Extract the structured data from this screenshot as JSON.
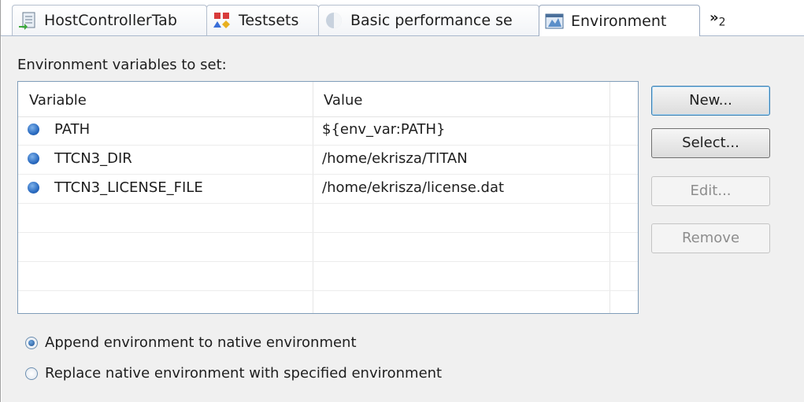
{
  "tabs": [
    {
      "label": "HostControllerTab",
      "icon": "host-controller-icon",
      "active": false
    },
    {
      "label": "Testsets",
      "icon": "testsets-icon",
      "active": false
    },
    {
      "label": "Basic performance se",
      "icon": "performance-icon",
      "active": false
    },
    {
      "label": "Environment",
      "icon": "environment-icon",
      "active": true
    }
  ],
  "overflow": {
    "chevron": "»",
    "count": "2"
  },
  "section_label": "Environment variables to set:",
  "table": {
    "columns": [
      "Variable",
      "Value"
    ],
    "rows": [
      {
        "variable": "PATH",
        "value": "${env_var:PATH}"
      },
      {
        "variable": "TTCN3_DIR",
        "value": "/home/ekrisza/TITAN"
      },
      {
        "variable": "TTCN3_LICENSE_FILE",
        "value": "/home/ekrisza/license.dat"
      }
    ]
  },
  "buttons": {
    "new": "New...",
    "select": "Select...",
    "edit": "Edit...",
    "remove": "Remove"
  },
  "radios": [
    {
      "label": "Append environment to native environment",
      "checked": true
    },
    {
      "label": "Replace native environment with specified environment",
      "checked": false
    }
  ],
  "colors": {
    "accent": "#3c7fb1",
    "bullet": "#2a6bc1",
    "panel": "#f0f0f0"
  }
}
